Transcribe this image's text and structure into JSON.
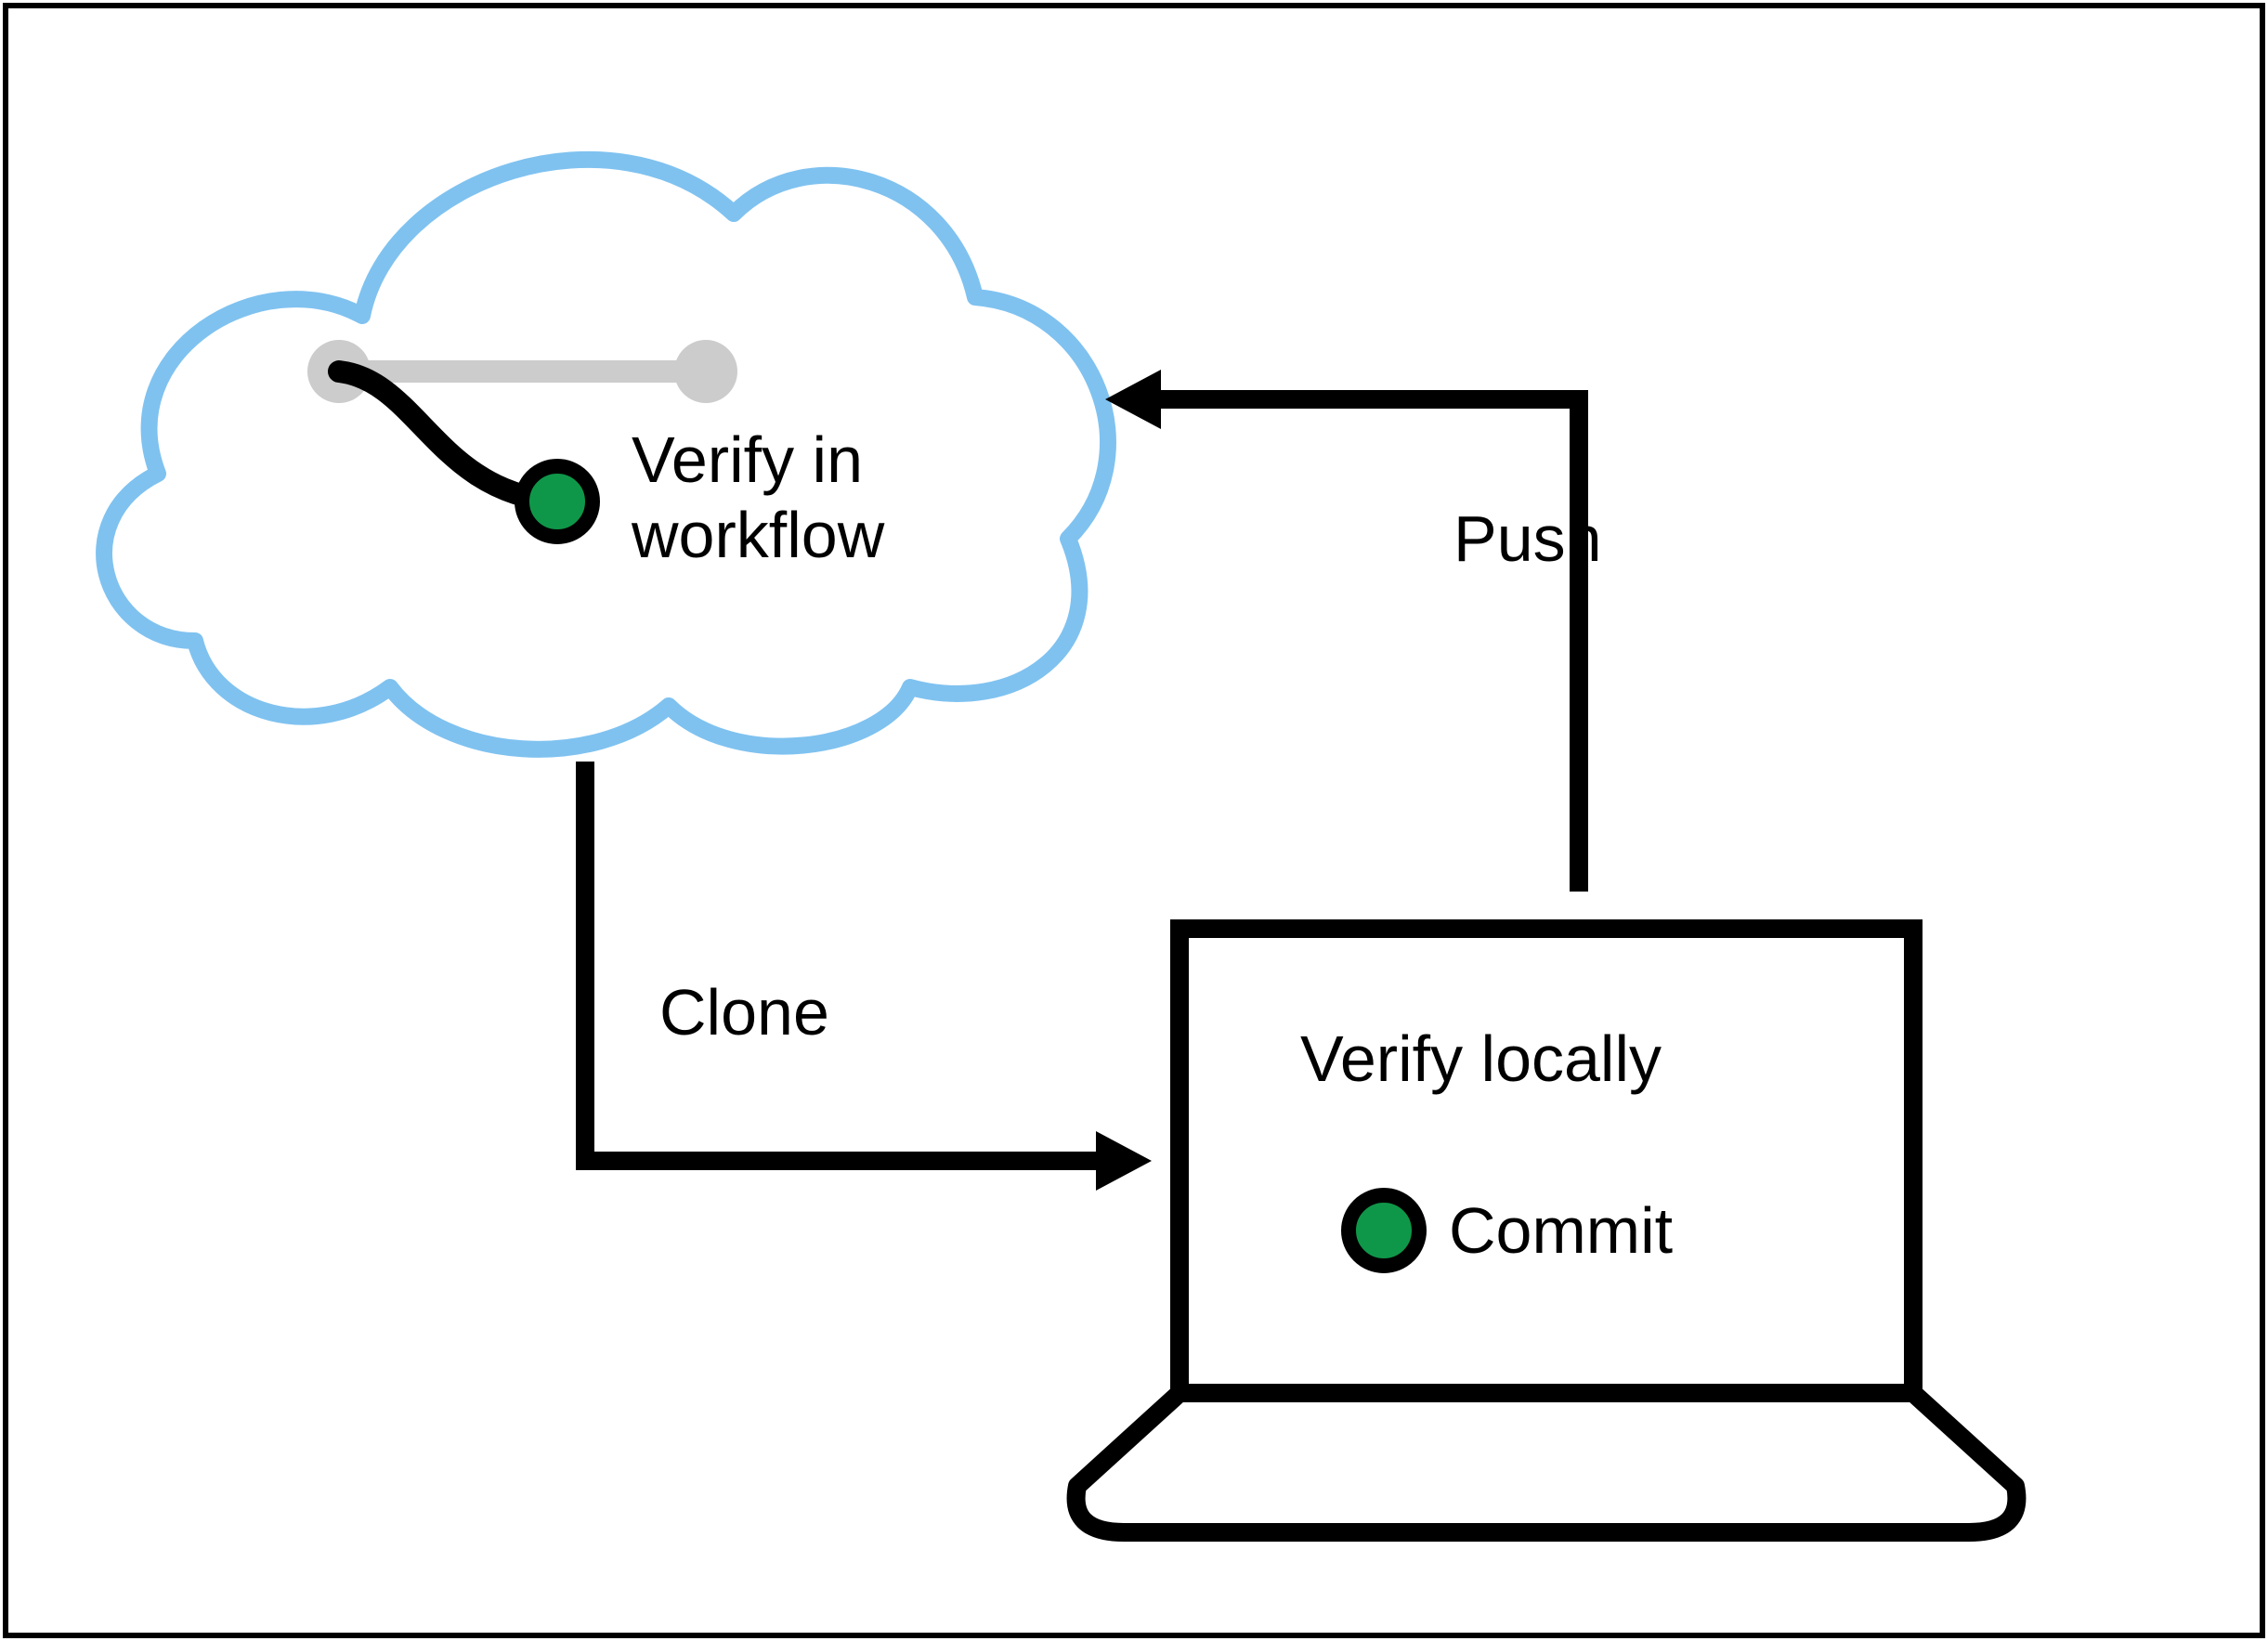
{
  "diagram": {
    "cloud": {
      "label": "Verify in\nworkflow"
    },
    "laptop": {
      "top_label": "Verify locally",
      "bottom_label": "Commit"
    },
    "arrows": {
      "clone_label": "Clone",
      "push_label": "Push"
    },
    "colors": {
      "cloud_stroke": "#7fc2f0",
      "commit_fill": "#0f9749",
      "inactive": "#cccccc",
      "black": "#000000"
    }
  }
}
